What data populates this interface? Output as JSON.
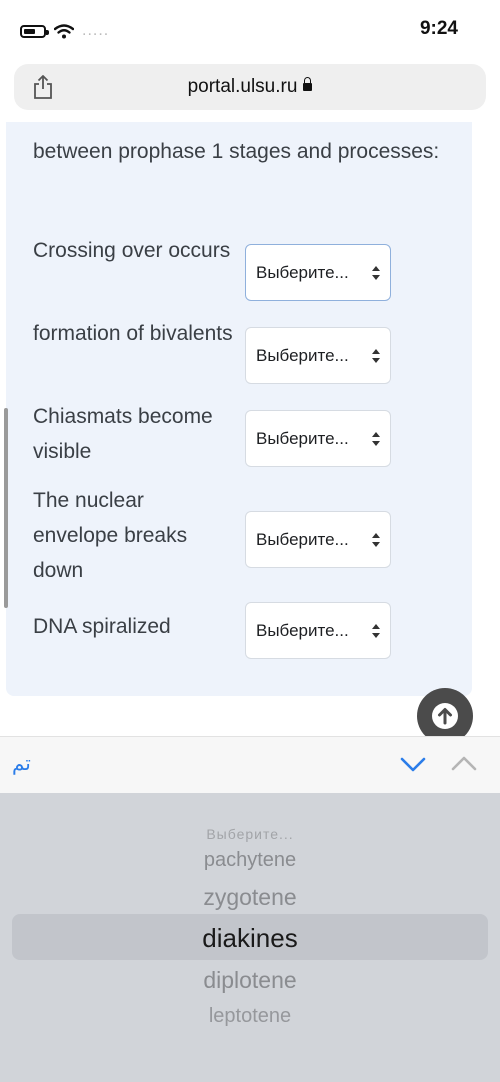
{
  "status_bar": {
    "time": "9:24",
    "signal_dots": "....."
  },
  "browser": {
    "url": "portal.ulsu.ru"
  },
  "question": {
    "intro": "between prophase 1 stages and processes:",
    "rows": [
      {
        "label": "Crossing over occurs",
        "select_value": "Выберите..."
      },
      {
        "label": "formation of bivalents",
        "select_value": "Выберите..."
      },
      {
        "label": "Chiasmats become visible",
        "select_value": "Выберите..."
      },
      {
        "label": "The nuclear envelope breaks down",
        "select_value": "Выберите..."
      },
      {
        "label": "DNA spiralized",
        "select_value": "Выберите..."
      }
    ]
  },
  "keyboard_accessory": {
    "done_label": "تم"
  },
  "picker": {
    "options": [
      "Выберите...",
      "pachytene",
      "zygotene",
      "diakines",
      "diplotene",
      "leptotene"
    ],
    "selected": "diakines"
  },
  "colors": {
    "accent": "#2b7de9",
    "panel_bg": "#eef3fb",
    "picker_bg": "#d1d4d9"
  }
}
